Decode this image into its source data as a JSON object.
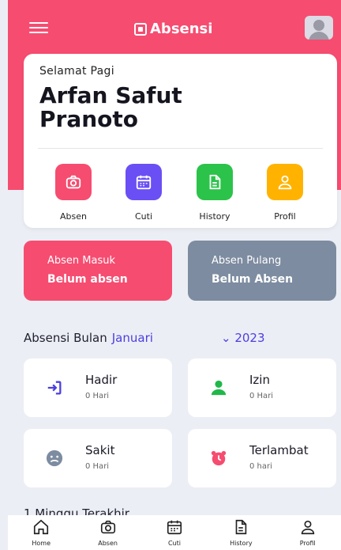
{
  "app": {
    "title": "Absensi",
    "accent": "#f64c70",
    "indigo": "#4b3fe0"
  },
  "greeting": {
    "label": "Selamat Pagi",
    "name": "Arfan Safut Pranoto"
  },
  "quick_actions": [
    {
      "label": "Absen",
      "icon": "camera-icon",
      "color": "#f64c70"
    },
    {
      "label": "Cuti",
      "icon": "calendar-icon",
      "color": "#6a4ff5"
    },
    {
      "label": "History",
      "icon": "document-icon",
      "color": "#2bc34a"
    },
    {
      "label": "Profil",
      "icon": "user-icon",
      "color": "#ffb300"
    }
  ],
  "status": {
    "in": {
      "title": "Absen Masuk",
      "value": "Belum absen",
      "color": "#f64c70"
    },
    "out": {
      "title": "Absen Pulang",
      "value": "Belum Absen",
      "color": "#7d8ca0"
    }
  },
  "month": {
    "label": "Absensi Bulan",
    "month": "Januari",
    "year": "⌄ 2023"
  },
  "stats": [
    {
      "name": "Hadir",
      "value": "0 Hari",
      "icon": "login-icon",
      "color": "#4b3fe0"
    },
    {
      "name": "Izin",
      "value": "0 Hari",
      "icon": "person-icon",
      "color": "#20b84a"
    },
    {
      "name": "Sakit",
      "value": "0 Hari",
      "icon": "sad-face-icon",
      "color": "#7d8ca0"
    },
    {
      "name": "Terlambat",
      "value": "0 hari",
      "icon": "alarm-clock-icon",
      "color": "#f64c70"
    }
  ],
  "week_title": "1 Minggu Terakhir",
  "nav": [
    {
      "label": "Home",
      "icon": "home-icon"
    },
    {
      "label": "Absen",
      "icon": "camera-icon"
    },
    {
      "label": "Cuti",
      "icon": "calendar-icon"
    },
    {
      "label": "History",
      "icon": "document-icon"
    },
    {
      "label": "Profil",
      "icon": "user-icon"
    }
  ]
}
